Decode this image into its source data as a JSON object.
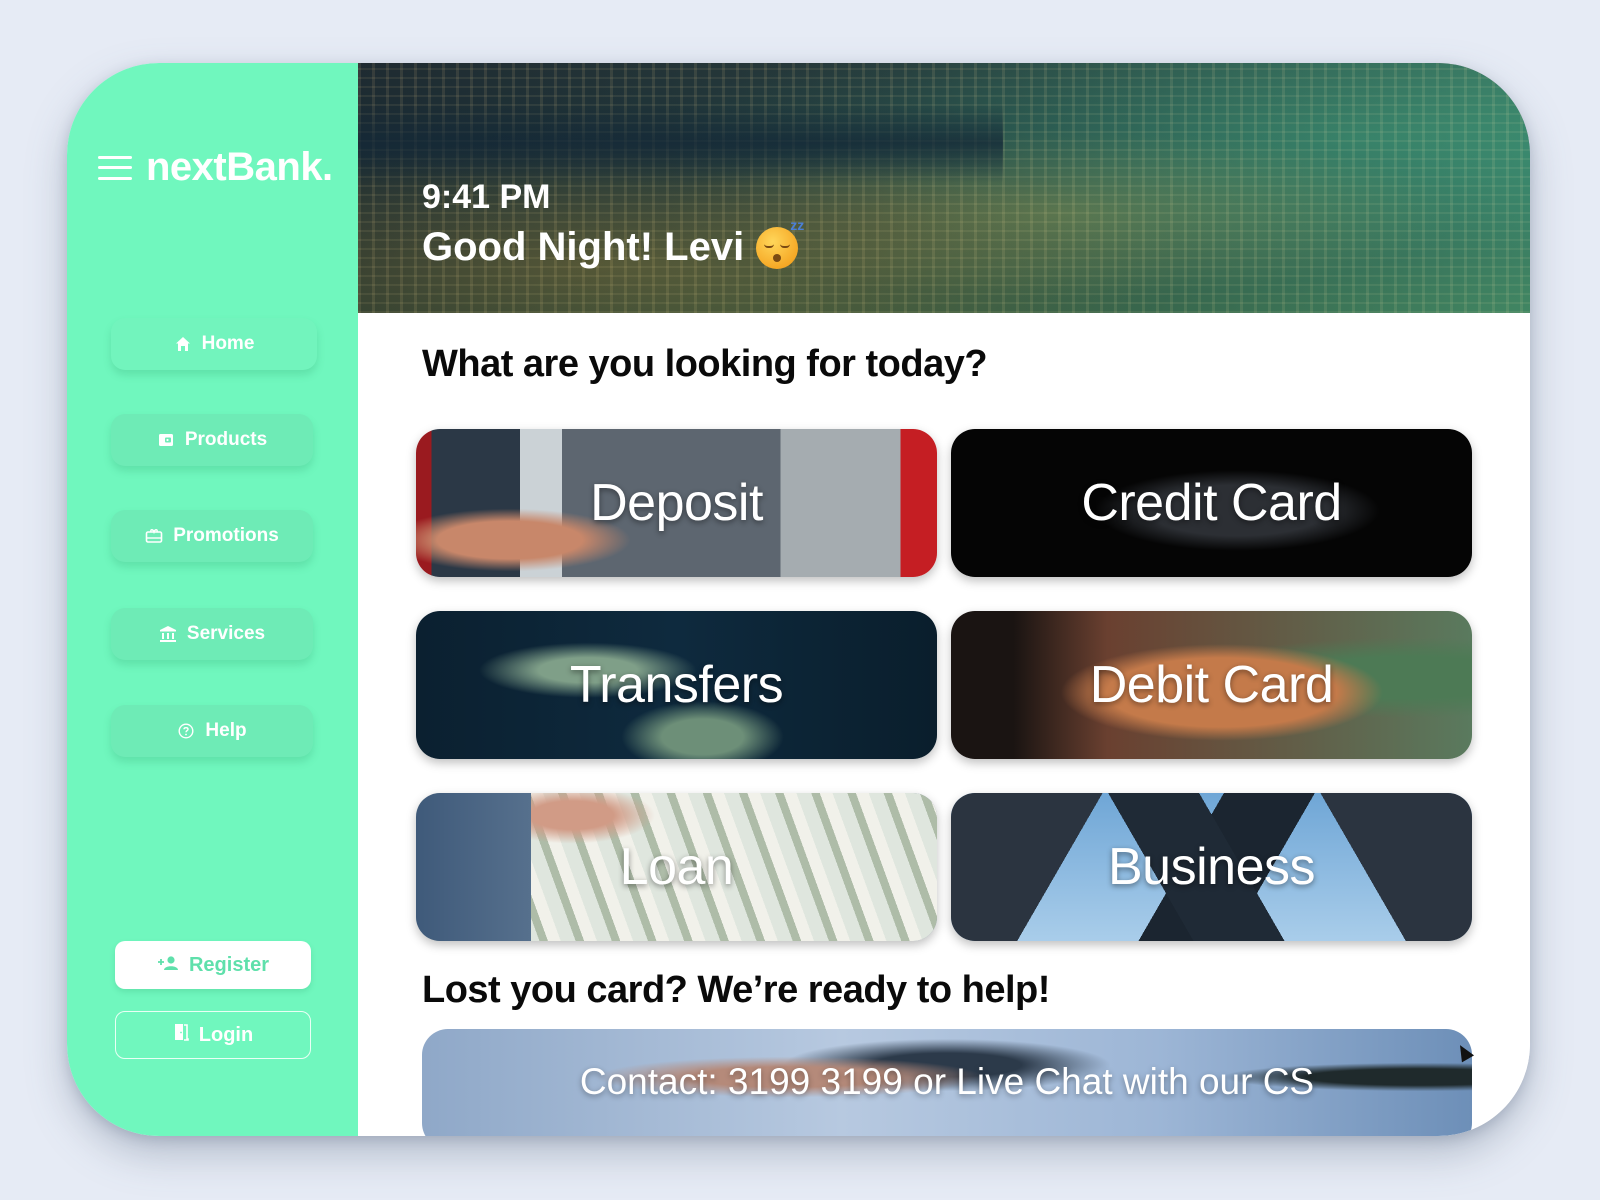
{
  "app": {
    "brand": "nextBank.",
    "brand_color": "#70f7be"
  },
  "sidebar": {
    "menu_icon": "hamburger-menu-icon",
    "items": [
      {
        "label": "Home",
        "icon": "home-icon",
        "active": true
      },
      {
        "label": "Products",
        "icon": "wallet-icon",
        "active": false
      },
      {
        "label": "Promotions",
        "icon": "gift-card-icon",
        "active": false
      },
      {
        "label": "Services",
        "icon": "bank-icon",
        "active": false
      },
      {
        "label": "Help",
        "icon": "help-circle-icon",
        "active": false
      }
    ],
    "register_label": "Register",
    "register_icon": "person-add-icon",
    "login_label": "Login",
    "login_icon": "door-icon"
  },
  "hero": {
    "time": "9:41 PM",
    "greeting": "Good Night! Levi",
    "emoji": "sleeping-face-emoji",
    "zz": "zz"
  },
  "main": {
    "section_title": "What are you looking for today?",
    "tiles": [
      {
        "label": "Deposit"
      },
      {
        "label": "Credit Card"
      },
      {
        "label": "Transfers"
      },
      {
        "label": "Debit Card"
      },
      {
        "label": "Loan"
      },
      {
        "label": "Business"
      }
    ],
    "help_title": "Lost you card? We’re ready to help!",
    "contact_label": "Contact: 3199 3199 or Live Chat with our CS"
  }
}
